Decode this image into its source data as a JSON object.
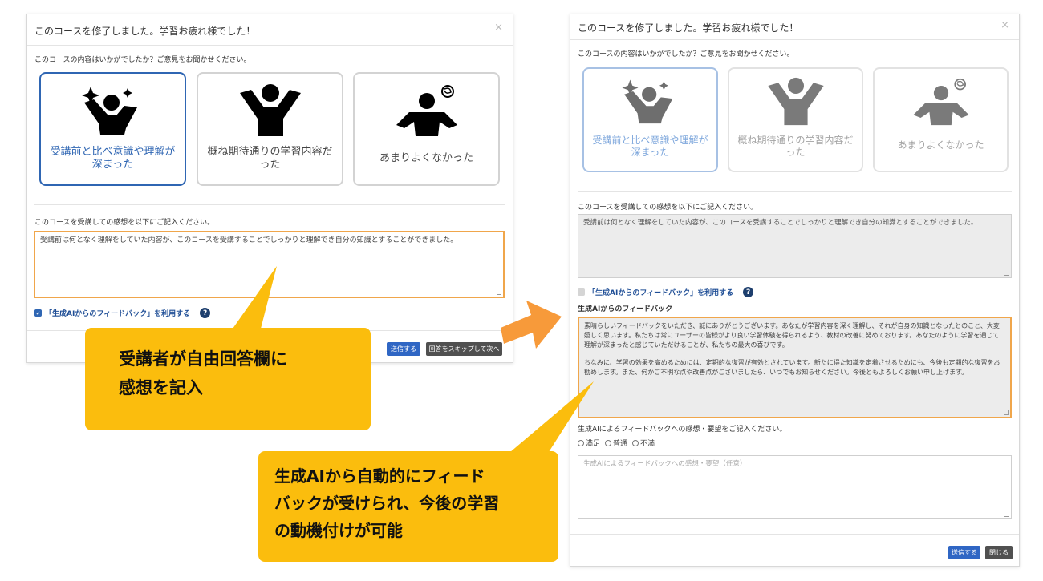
{
  "dialog": {
    "title": "このコースを修了しました。学習お疲れ様でした！",
    "close_icon": "×",
    "question": "このコースの内容はいかがでしたか？ご意見をお聞かせください。",
    "options": [
      {
        "label": "受講前と比べ意識や理解が深まった",
        "icon": "sparkle-person-icon"
      },
      {
        "label": "概ね期待通りの学習内容だった",
        "icon": "person-arms-up-icon"
      },
      {
        "label": "あまりよくなかった",
        "icon": "confused-person-icon"
      }
    ],
    "impression_prompt": "このコースを受講しての感想を以下にご記入ください。",
    "impression_text": "受講前は何となく理解をしていた内容が、このコースを受講することでしっかりと理解でき自分の知識とすることができました。",
    "ai_checkbox_label": "「生成AIからのフィードバック」を利用する",
    "help_icon": "?",
    "submit_label": "送信する",
    "skip_label": "回答をスキップして次へ",
    "close_label": "閉じる",
    "ai_feedback_heading": "生成AIからのフィードバック",
    "ai_feedback_para1": "素晴らしいフィードバックをいただき、誠にありがとうございます。あなたが学習内容を深く理解し、それが自身の知識となったとのこと、大変嬉しく思います。私たちは常にユーザーの皆様がより良い学習体験を得られるよう、教材の改善に努めております。あなたのように学習を通じて理解が深まったと感じていただけることが、私たちの最大の喜びです。",
    "ai_feedback_para2": "ちなみに、学習の効果を高めるためには、定期的な復習が有効とされています。新たに得た知識を定着させるためにも、今後も定期的な復習をお勧めします。また、何かご不明な点や改善点がございましたら、いつでもお知らせください。今後ともよろしくお願い申し上げます。",
    "ai_rating_prompt": "生成AIによるフィードバックへの感想・要望をご記入ください。",
    "ai_rating_options": [
      "満足",
      "普通",
      "不満"
    ],
    "ai_comment_placeholder": "生成AIによるフィードバックへの感想・要望（任意）"
  },
  "callouts": {
    "left_line1": "受講者が自由回答欄に",
    "left_line2": "感想を記入",
    "right_line1": "生成AIから自動的にフィード",
    "right_line2": "バックが受けられ、今後の学習",
    "right_line3": "の動機付けが可能"
  },
  "colors": {
    "accent_blue": "#2f66b3",
    "highlight_orange": "#f0a64b",
    "callout_yellow": "#fbbd0d",
    "arrow_orange": "#f79a3a"
  }
}
